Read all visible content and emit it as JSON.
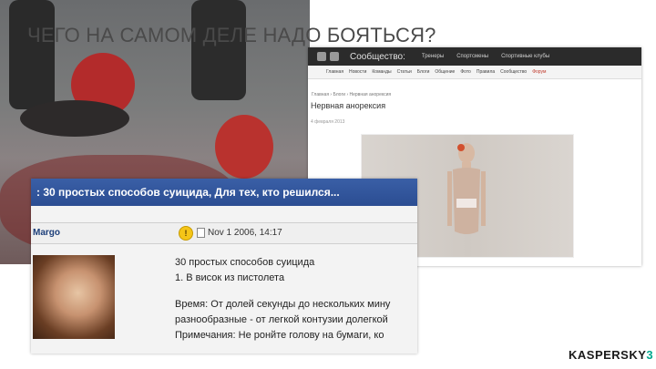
{
  "slide": {
    "title": "ЧЕГО НА САМОМ ДЕЛЕ НАДО БОЯТЬСЯ?"
  },
  "news_site": {
    "community_label": "Сообщество:",
    "top_links": [
      "Тренеры",
      "Спортсмены",
      "Спортивные клубы"
    ],
    "nav_items": [
      "Главная",
      "Новости",
      "Команды",
      "Статьи",
      "Блоги",
      "Общение",
      "Фото",
      "Правила",
      "Сообщество",
      "Форум"
    ],
    "breadcrumb": "Главная › Блоги › Нервная анорексия",
    "article_title": "Нервная анорексия",
    "article_date": "4 февраля 2013"
  },
  "forum": {
    "thread_title": ": 30 простых способов суицида, Для тех, кто решился...",
    "username": "Margo",
    "post_date": "Nov 1 2006, 14:17",
    "status_icon": "warning-face-icon",
    "body_lines": [
      "30 простых способов суицида",
      "1. В висок из пистолета",
      "",
      "Время: От долей секунды до нескольких мину",
      "разнообразные - от легкой контузии долегкой",
      "Примечания: Не ронйте голову на бумаги, ко"
    ]
  },
  "brand": {
    "name_main": "KASPERSKY",
    "name_accent": "3"
  },
  "colors": {
    "forum_header": "#2b4d92",
    "brand_accent": "#00a88e",
    "title_text": "#4a4a4a"
  }
}
